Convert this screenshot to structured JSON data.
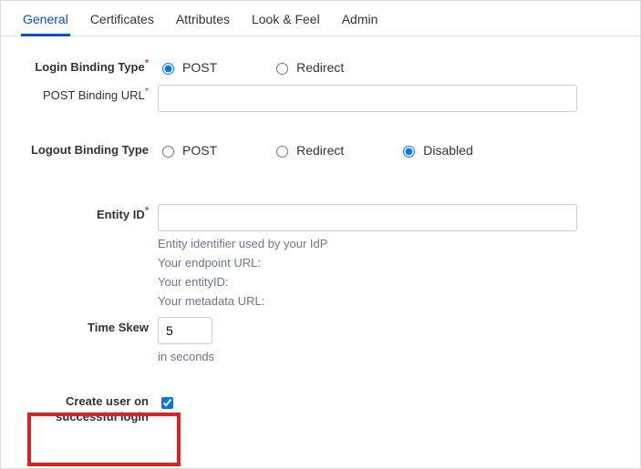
{
  "tabs": {
    "general": "General",
    "certificates": "Certificates",
    "attributes": "Attributes",
    "lookfeel": "Look & Feel",
    "admin": "Admin"
  },
  "labels": {
    "loginBindingType": "Login Binding Type",
    "postBindingUrl": "POST Binding URL",
    "logoutBindingType": "Logout Binding Type",
    "entityId": "Entity ID",
    "timeSkew": "Time Skew",
    "createUser": "Create user on successful login"
  },
  "options": {
    "post": "POST",
    "redirect": "Redirect",
    "disabled": "Disabled"
  },
  "values": {
    "loginBinding": "POST",
    "logoutBinding": "Disabled",
    "postBindingUrl": "",
    "entityId": "",
    "timeSkew": "5",
    "createUser": true
  },
  "hints": {
    "entityIdDesc": "Entity identifier used by your IdP",
    "endpointUrl": "Your endpoint URL:",
    "yourEntityId": "Your entityID:",
    "metadataUrl": "Your metadata URL:",
    "timeSkewUnit": "in seconds"
  }
}
